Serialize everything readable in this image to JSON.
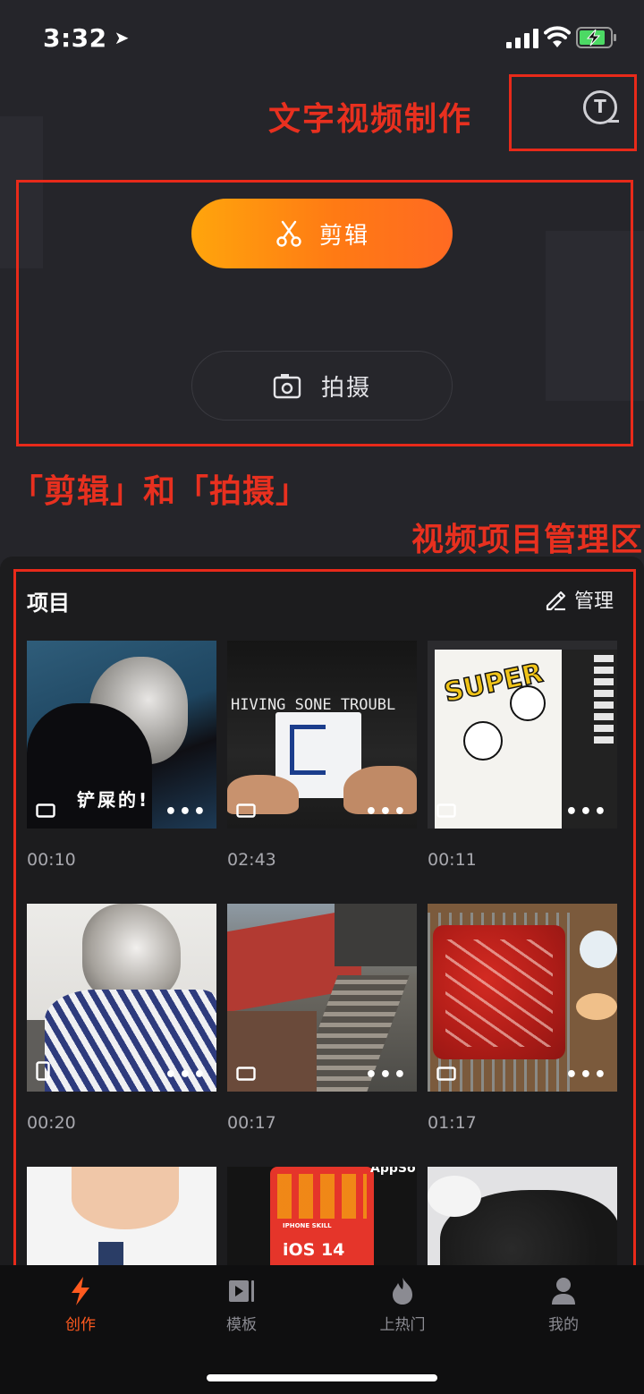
{
  "status_bar": {
    "time": "3:32",
    "location_icon": "location-arrow-icon",
    "battery_color": "#4cd964"
  },
  "header": {
    "annotation_title": "文字视频制作",
    "text_tool_glyph": "T"
  },
  "actions": {
    "edit_label": "剪辑",
    "shoot_label": "拍摄"
  },
  "annotations": {
    "edit_shoot": "「剪辑」和「拍摄」",
    "project_area": "视频项目管理区"
  },
  "projects": {
    "title": "项目",
    "manage_label": "管理",
    "more_glyph": "•••",
    "items": [
      {
        "duration": "00:10",
        "caption": "铲屎的!",
        "orientation": "landscape"
      },
      {
        "duration": "02:43",
        "caption": "HIVING SONE TROUBL",
        "orientation": "landscape"
      },
      {
        "duration": "00:11",
        "caption": "SUPER",
        "orientation": "landscape"
      },
      {
        "duration": "00:20",
        "caption": "",
        "orientation": "portrait"
      },
      {
        "duration": "00:17",
        "caption": "",
        "orientation": "landscape"
      },
      {
        "duration": "01:17",
        "caption": "",
        "orientation": "landscape"
      },
      {
        "duration": "",
        "caption": "",
        "orientation": ""
      },
      {
        "duration": "",
        "caption": "iOS 14",
        "overlay_small": "IPHONE SKILL",
        "corner_text": "AppSo",
        "orientation": ""
      },
      {
        "duration": "",
        "caption": "",
        "orientation": ""
      }
    ]
  },
  "tabbar": {
    "items": [
      {
        "label": "创作",
        "icon": "lightning-icon",
        "active": true
      },
      {
        "label": "模板",
        "icon": "template-play-icon",
        "active": false
      },
      {
        "label": "上热门",
        "icon": "flame-icon",
        "active": false
      },
      {
        "label": "我的",
        "icon": "person-icon",
        "active": false
      }
    ],
    "active_color": "#ff5a1f",
    "inactive_color": "#8b8b92"
  },
  "colors": {
    "accent_orange": "#ff7a14",
    "annotation_red": "#e8301f",
    "background": "#25252a",
    "panel": "#1c1c1e"
  }
}
